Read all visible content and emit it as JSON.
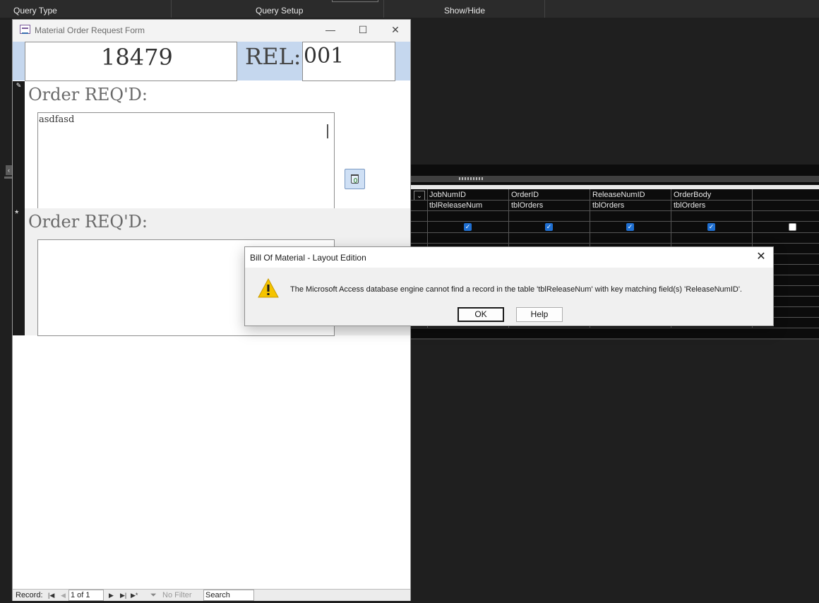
{
  "ribbon": {
    "groups": [
      "Query Type",
      "Query Setup",
      "Show/Hide"
    ]
  },
  "form_window": {
    "title": "Material Order Request Form",
    "controls": {
      "minimize": "—",
      "maximize": "☐",
      "close": "✕"
    },
    "job_number": "18479",
    "rel_label": "REL:",
    "rel_value": "001",
    "sections": [
      {
        "label": "Order REQ'D:",
        "memo_text": "asdfasd"
      },
      {
        "label": "Order REQ'D:",
        "memo_text": ""
      }
    ],
    "nav": {
      "record_label": "Record:",
      "record_value": "1 of 1",
      "filter_label": "No Filter",
      "search_placeholder": "Search"
    }
  },
  "query_grid": {
    "fields": [
      {
        "field": "JobNumID",
        "table": "tblReleaseNum",
        "show": true
      },
      {
        "field": "OrderID",
        "table": "tblOrders",
        "show": true
      },
      {
        "field": "ReleaseNumID",
        "table": "tblOrders",
        "show": true
      },
      {
        "field": "OrderBody",
        "table": "tblOrders",
        "show": true
      },
      {
        "field": "",
        "table": "",
        "show": false
      }
    ]
  },
  "dialog": {
    "title": "Bill Of Material - Layout Edition",
    "message": "The Microsoft Access database engine cannot find a record in the table 'tblReleaseNum' with key matching field(s) 'ReleaseNumID'.",
    "ok_label": "OK",
    "help_label": "Help",
    "icon": "warning-icon"
  },
  "colors": {
    "header_band": "#c5d7ee",
    "checkbox_on": "#1f6fd1",
    "dark_bg": "#1f1f1f"
  }
}
